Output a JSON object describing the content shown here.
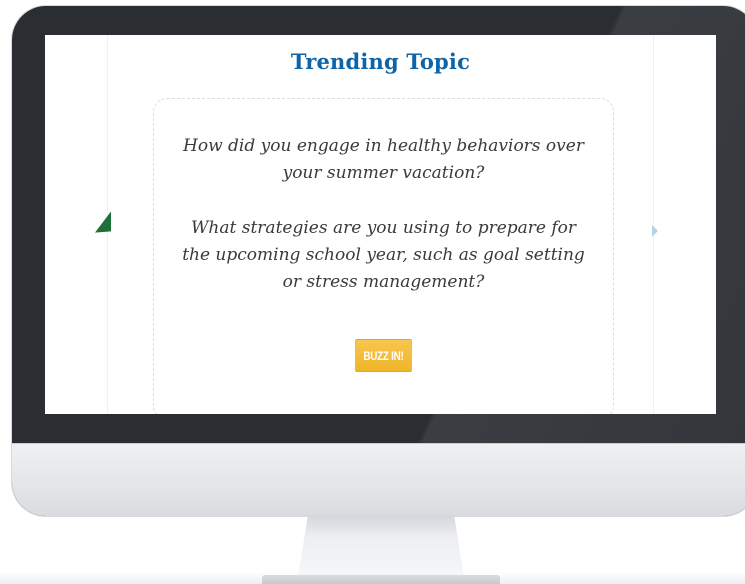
{
  "screen": {
    "title": "Trending Topic",
    "questions": [
      "How did you engage in healthy behaviors over your summer vacation?",
      "What strategies are you using to prepare for the upcoming school year, such as goal setting or stress management?"
    ],
    "buzz_button_label": "BUZZ IN!"
  },
  "colors": {
    "title": "#0e64a8",
    "button": "#f0b628",
    "bezel": "#2a2d31",
    "left_arrow": "#1f6f3a"
  },
  "icons": {
    "left": "chevron-left-icon",
    "right": "chevron-right-icon"
  }
}
